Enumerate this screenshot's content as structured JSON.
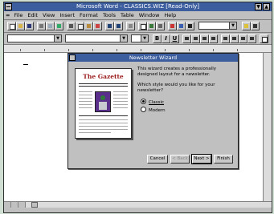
{
  "window": {
    "title": "Microsoft Word - CLASSICS.WIZ [Read-Only]",
    "minimize": "▼",
    "maximize": "▲"
  },
  "menu": {
    "doc_sys": "=",
    "items": [
      "File",
      "Edit",
      "View",
      "Insert",
      "Format",
      "Tools",
      "Table",
      "Window",
      "Help"
    ]
  },
  "format_bar": {
    "bold": "B",
    "italic": "I",
    "underline": "U"
  },
  "dialog": {
    "title": "Newsletter Wizard",
    "preview_title": "The Gazette",
    "intro": "This wizard creates a professionally designed layout for a newsletter.",
    "question": "Which style would you like for your newsletter?",
    "options": [
      {
        "label": "Classic",
        "selected": true
      },
      {
        "label": "Modern",
        "selected": false
      }
    ],
    "buttons": {
      "cancel": "Cancel",
      "back": "< Back",
      "next": "Next >",
      "finish": "Finish"
    }
  },
  "colors": {
    "titlebar": "#3c5e9f",
    "chrome": "#c0c0c0",
    "desktop": "#cfe0d2",
    "gazette_title": "#9a1b1b"
  }
}
